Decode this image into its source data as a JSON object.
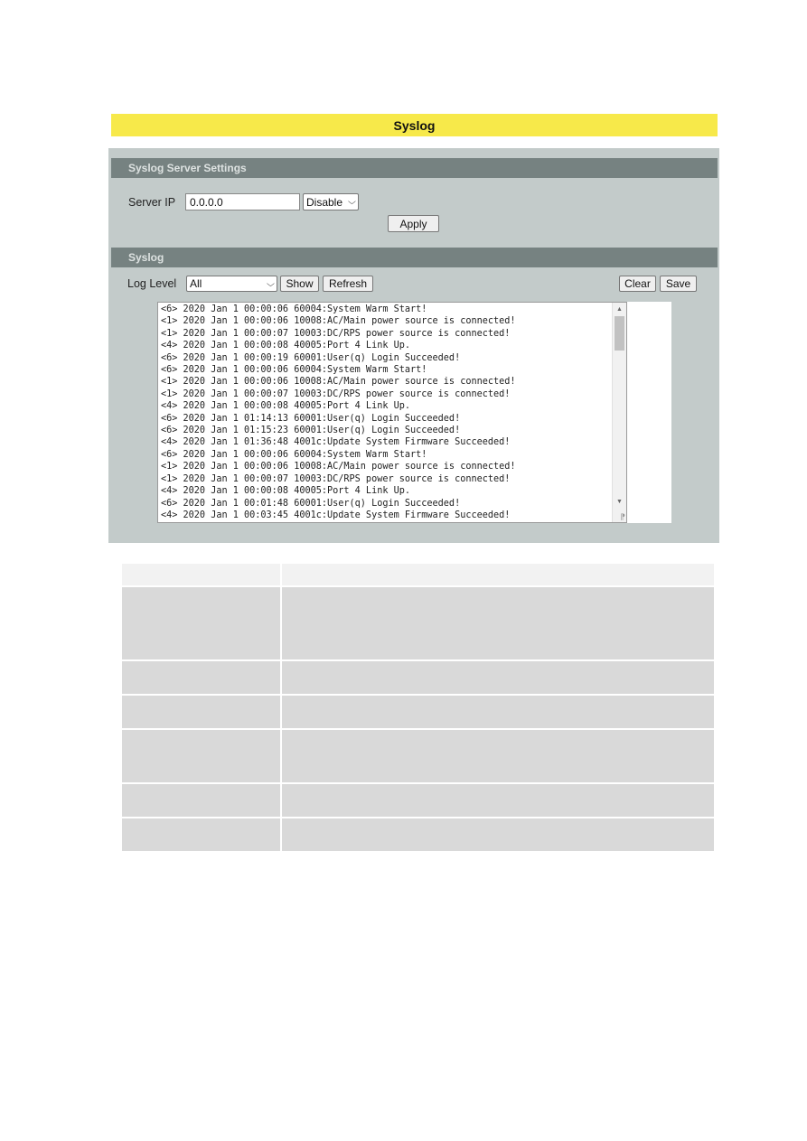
{
  "title": "Syslog",
  "server_settings": {
    "header": "Syslog Server Settings",
    "server_ip_label": "Server IP",
    "server_ip_value": "0.0.0.0",
    "mode_select": {
      "selected": "Disable"
    },
    "apply_label": "Apply"
  },
  "syslog": {
    "header": "Syslog",
    "log_level_label": "Log Level",
    "log_level_select": {
      "selected": "All"
    },
    "show_label": "Show",
    "refresh_label": "Refresh",
    "clear_label": "Clear",
    "save_label": "Save",
    "log_lines": [
      "<6> 2020 Jan 1 00:00:06 60004:System Warm Start!",
      "<1> 2020 Jan 1 00:00:06 10008:AC/Main power source is connected!",
      "<1> 2020 Jan 1 00:00:07 10003:DC/RPS power source is connected!",
      "<4> 2020 Jan 1 00:00:08 40005:Port 4 Link Up.",
      "<6> 2020 Jan 1 00:00:19 60001:User(q) Login Succeeded!",
      "<6> 2020 Jan 1 00:00:06 60004:System Warm Start!",
      "<1> 2020 Jan 1 00:00:06 10008:AC/Main power source is connected!",
      "<1> 2020 Jan 1 00:00:07 10003:DC/RPS power source is connected!",
      "<4> 2020 Jan 1 00:00:08 40005:Port 4 Link Up.",
      "<6> 2020 Jan 1 01:14:13 60001:User(q) Login Succeeded!",
      "<6> 2020 Jan 1 01:15:23 60001:User(q) Login Succeeded!",
      "<4> 2020 Jan 1 01:36:48 4001c:Update System Firmware Succeeded!",
      "<6> 2020 Jan 1 00:00:06 60004:System Warm Start!",
      "<1> 2020 Jan 1 00:00:06 10008:AC/Main power source is connected!",
      "<1> 2020 Jan 1 00:00:07 10003:DC/RPS power source is connected!",
      "<4> 2020 Jan 1 00:00:08 40005:Port 4 Link Up.",
      "<6> 2020 Jan 1 00:01:48 60001:User(q) Login Succeeded!",
      "<4> 2020 Jan 1 00:03:45 4001c:Update System Firmware Succeeded!"
    ],
    "scroll_up_icon": "triangle-up",
    "scroll_down_icon": "triangle-down",
    "resize_icon": "resize-grip"
  },
  "description_table": {
    "header": [
      "",
      ""
    ],
    "rows": [
      [
        "",
        ""
      ],
      [
        "",
        ""
      ],
      [
        "",
        ""
      ],
      [
        "",
        ""
      ],
      [
        "",
        ""
      ],
      [
        "",
        ""
      ]
    ]
  }
}
